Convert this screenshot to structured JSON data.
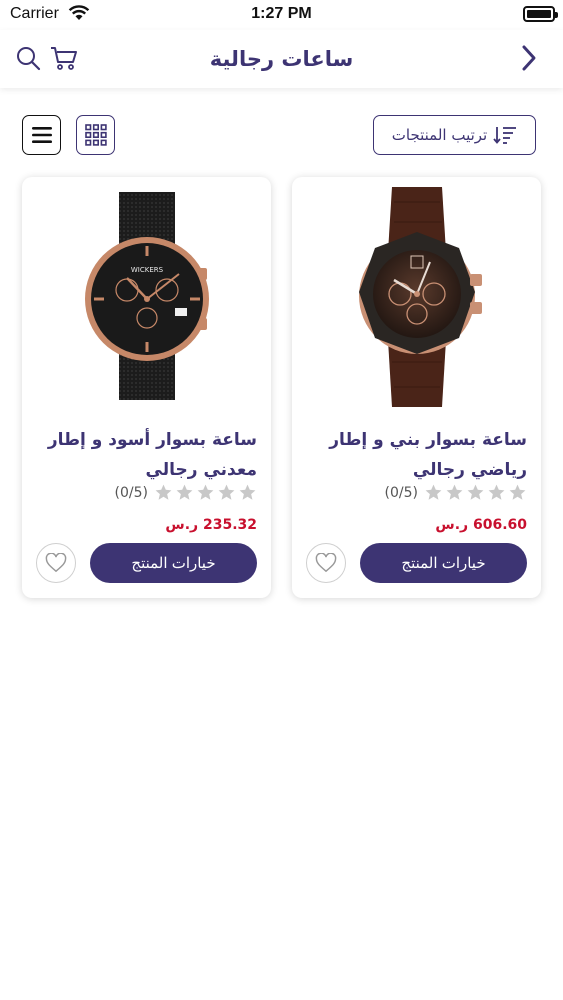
{
  "status_bar": {
    "carrier": "Carrier",
    "time": "1:27 PM"
  },
  "header": {
    "title": "ساعات رجالية"
  },
  "toolbar": {
    "sort_label": "ترتيب المنتجات"
  },
  "products": [
    {
      "title": "ساعة بسوار بني و إطار رياضي رجالي",
      "rating_text": "(0/5)",
      "rating": 0,
      "price": "606.60 ر.س",
      "options_label": "خيارات المنتج"
    },
    {
      "title": "ساعة بسوار أسود و إطار معدني رجالي",
      "brand_mark": "WICKERS",
      "rating_text": "(0/5)",
      "rating": 0,
      "price": "235.32 ر.س",
      "options_label": "خيارات المنتج"
    }
  ],
  "colors": {
    "primary": "#3d3473",
    "price": "#c8102e",
    "star_empty": "#c8c8c8"
  }
}
